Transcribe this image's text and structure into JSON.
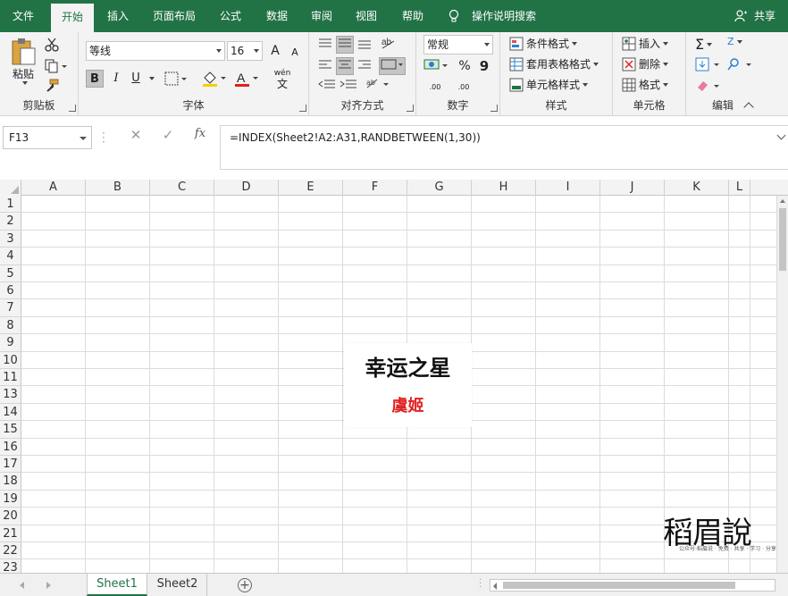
{
  "ribbon_tabs": [
    "文件",
    "开始",
    "插入",
    "页面布局",
    "公式",
    "数据",
    "审阅",
    "视图",
    "帮助"
  ],
  "active_tab": "开始",
  "tell_me": "操作说明搜索",
  "share": "共享",
  "clipboard": {
    "paste": "粘贴",
    "label": "剪贴板"
  },
  "font": {
    "name": "等线",
    "size": "16",
    "bold": "B",
    "italic": "I",
    "underline": "U",
    "label": "字体",
    "grow": "A",
    "shrink": "A",
    "phonetic": "wén"
  },
  "alignment": {
    "label": "对齐方式"
  },
  "number": {
    "format": "常规",
    "percent": "%",
    "comma": "9",
    "label": "数字",
    "inc_decimal": ".00",
    "dec_decimal": ".00"
  },
  "styles": {
    "conditional": "条件格式",
    "table": "套用表格格式",
    "cell": "单元格样式",
    "label": "样式"
  },
  "cells": {
    "insert": "插入",
    "delete": "删除",
    "format": "格式",
    "label": "单元格"
  },
  "editing": {
    "label": "编辑",
    "sum": "Σ",
    "sort": "Z"
  },
  "formula_bar": {
    "name_box": "F13",
    "cancel": "✕",
    "enter": "✓",
    "fx": "fx",
    "formula": "=INDEX(Sheet2!A2:A31,RANDBETWEEN(1,30))"
  },
  "columns": [
    "A",
    "B",
    "C",
    "D",
    "E",
    "F",
    "G",
    "H",
    "I",
    "J",
    "K",
    "L"
  ],
  "rows": [
    "1",
    "2",
    "3",
    "4",
    "5",
    "6",
    "7",
    "8",
    "9",
    "10",
    "11",
    "13",
    "14",
    "15",
    "16",
    "17",
    "18",
    "19",
    "20",
    "21",
    "22",
    "23"
  ],
  "card": {
    "title": "幸运之星",
    "name": "虞姬"
  },
  "watermark": {
    "text": "稻眉說",
    "sub": "公众号:稻眉说 · 免费 · 共享 · 学习 · 分享"
  },
  "sheets": [
    "Sheet1",
    "Sheet2"
  ],
  "active_sheet": "Sheet1",
  "add_sheet": "+",
  "colors": {
    "excel_green": "#217346",
    "name_red": "#e02020"
  }
}
